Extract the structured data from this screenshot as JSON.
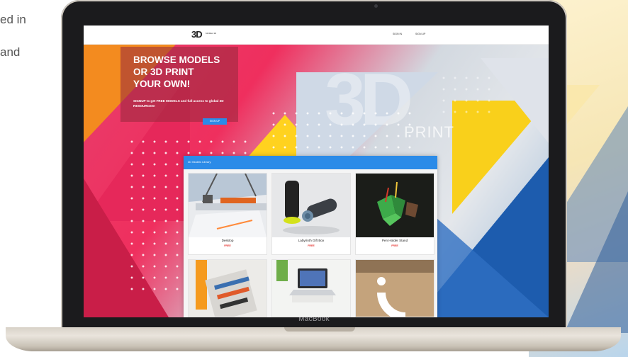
{
  "side_text": {
    "line1": "ed in",
    "line2": "and"
  },
  "laptop": {
    "brand": "MacBook"
  },
  "site": {
    "logo": "3D",
    "logo_text": "MODEL 3D",
    "nav": {
      "signin": "SIGN IN",
      "signup": "SIGN UP"
    },
    "hero": {
      "title_lines": [
        "BROWSE MODELS",
        "OR 3D PRINT",
        "YOUR OWN!"
      ],
      "subtitle": "SIGNUP to get FREE MODELS and full access to global 3D RESOURCES!",
      "cta": "SIGN UP",
      "bg_text": "3D",
      "bg_word": "PRINT"
    },
    "library": {
      "title": "3D Models Library",
      "items": [
        {
          "name": "Desktop",
          "price": "FREE"
        },
        {
          "name": "Labyrinth Gift Box",
          "price": "FREE"
        },
        {
          "name": "Pen Holder Stand",
          "price": "FREE"
        }
      ]
    }
  },
  "colors": {
    "accent_blue": "#2b8be8",
    "hero_pink": "#ef2f5e",
    "price_red": "#e53935"
  }
}
